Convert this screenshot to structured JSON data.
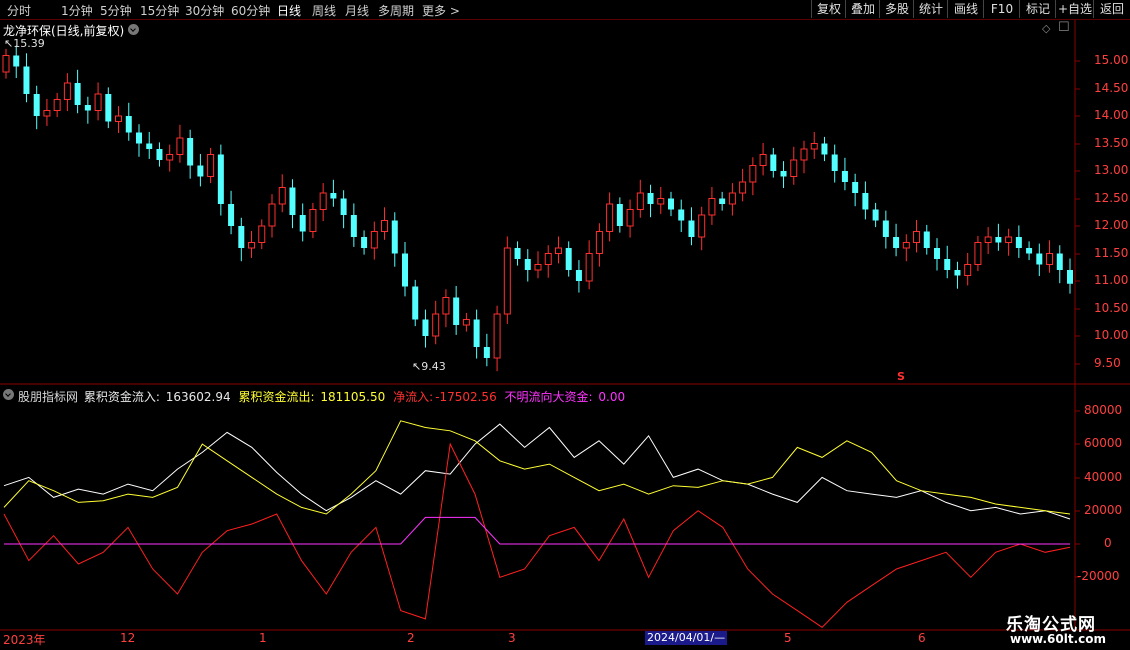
{
  "toolbar": {
    "timeframes": [
      "分时",
      "1分钟",
      "5分钟",
      "15分钟",
      "30分钟",
      "60分钟",
      "日线",
      "周线",
      "月线",
      "多周期",
      "更多 >"
    ],
    "active": "日线",
    "right_buttons": [
      "复权",
      "叠加",
      "多股",
      "统计",
      "画线",
      "F10",
      "标记",
      "+自选",
      "返回"
    ]
  },
  "price_panel": {
    "title": "龙净环保(日线,前复权)",
    "high_marker": "15.39",
    "low_marker": "9.43",
    "y_ticks": [
      "15.00",
      "14.50",
      "14.00",
      "13.50",
      "13.00",
      "12.50",
      "12.00",
      "11.50",
      "11.00",
      "10.50",
      "10.00",
      "9.50"
    ],
    "event_glyph": "S"
  },
  "indicator_panel": {
    "name": "股朋指标网",
    "items": [
      {
        "label": "累积资金流入:",
        "value": "163602.94",
        "color": "#e8e8e8"
      },
      {
        "label": "累积资金流出:",
        "value": "181105.50",
        "color": "#ffff33"
      },
      {
        "label": "净流入:",
        "value": "-17502.56",
        "color": "#ff3030"
      },
      {
        "label": "不明流向大资金:",
        "value": "0.00",
        "color": "#ff33ff"
      }
    ],
    "y_ticks": [
      "80000",
      "60000",
      "40000",
      "20000",
      "0",
      "-20000"
    ]
  },
  "date_axis": {
    "labels": [
      "2023年",
      "12",
      "1",
      "2",
      "3",
      "4",
      "5",
      "6"
    ],
    "cursor_date": "2024/04/01/—"
  },
  "watermark": {
    "line1": "乐淘公式网",
    "line2": "www.60lt.com"
  },
  "chart_data": [
    {
      "type": "candlestick",
      "title": "龙净环保(日线,前复权)",
      "ylim": [
        9.2,
        15.6
      ],
      "annotations": {
        "high": 15.39,
        "low": 9.43
      },
      "close": [
        15.1,
        14.9,
        14.4,
        14.0,
        14.1,
        14.3,
        14.6,
        14.2,
        14.1,
        14.4,
        13.9,
        14.0,
        13.7,
        13.5,
        13.4,
        13.2,
        13.3,
        13.6,
        13.1,
        12.9,
        13.3,
        12.4,
        12.0,
        11.6,
        11.7,
        12.0,
        12.4,
        12.7,
        12.2,
        11.9,
        12.3,
        12.6,
        12.5,
        12.2,
        11.8,
        11.6,
        11.9,
        12.1,
        11.5,
        10.9,
        10.3,
        10.0,
        10.4,
        10.7,
        10.2,
        10.3,
        9.8,
        9.6,
        10.4,
        11.6,
        11.4,
        11.2,
        11.3,
        11.5,
        11.6,
        11.2,
        11.0,
        11.5,
        11.9,
        12.4,
        12.0,
        12.3,
        12.6,
        12.4,
        12.5,
        12.3,
        12.1,
        11.8,
        12.2,
        12.5,
        12.4,
        12.6,
        12.8,
        13.1,
        13.3,
        13.0,
        12.9,
        13.2,
        13.4,
        13.5,
        13.3,
        13.0,
        12.8,
        12.6,
        12.3,
        12.1,
        11.8,
        11.6,
        11.7,
        11.9,
        11.6,
        11.4,
        11.2,
        11.1,
        11.3,
        11.7,
        11.8,
        11.7,
        11.8,
        11.6,
        11.5,
        11.3,
        11.5,
        11.2,
        10.95
      ]
    },
    {
      "type": "line",
      "ylim": [
        -25000,
        88000
      ],
      "categories": [
        "2023年",
        "12",
        "1",
        "2",
        "3",
        "4",
        "5",
        "6"
      ],
      "series": [
        {
          "name": "累积资金流入",
          "values": [
            35000,
            40000,
            28000,
            33000,
            30000,
            36000,
            32000,
            45000,
            55000,
            67000,
            58000,
            43000,
            30000,
            20000,
            28000,
            38000,
            30000,
            44000,
            42000,
            60000,
            72000,
            58000,
            70000,
            52000,
            62000,
            48000,
            65000,
            40000,
            45000,
            38000,
            36000,
            30000,
            25000,
            40000,
            32000,
            30000,
            28000,
            32000,
            25000,
            20000,
            22000,
            18000,
            20000,
            15000
          ]
        },
        {
          "name": "累积资金流出",
          "values": [
            22000,
            38000,
            32000,
            25000,
            26000,
            30000,
            28000,
            34000,
            60000,
            50000,
            40000,
            30000,
            22000,
            18000,
            30000,
            44000,
            74000,
            70000,
            68000,
            62000,
            50000,
            45000,
            48000,
            40000,
            32000,
            36000,
            30000,
            35000,
            34000,
            38000,
            36000,
            40000,
            58000,
            52000,
            62000,
            55000,
            38000,
            32000,
            30000,
            28000,
            24000,
            22000,
            20000,
            18000
          ]
        },
        {
          "name": "净流入",
          "values": [
            18000,
            -10000,
            5000,
            -12000,
            -5000,
            10000,
            -15000,
            -30000,
            -5000,
            8000,
            12000,
            18000,
            -10000,
            -30000,
            -5000,
            10000,
            -40000,
            -45000,
            60000,
            30000,
            -20000,
            -15000,
            5000,
            10000,
            -10000,
            15000,
            -20000,
            8000,
            20000,
            10000,
            -15000,
            -30000,
            -40000,
            -50000,
            -35000,
            -25000,
            -15000,
            -10000,
            -5000,
            -20000,
            -5000,
            0,
            -5000,
            -2000
          ]
        },
        {
          "name": "不明流向大资金",
          "values": [
            0,
            0,
            0,
            0,
            0,
            0,
            0,
            0,
            0,
            0,
            0,
            0,
            0,
            0,
            0,
            0,
            0,
            16000,
            16000,
            16000,
            0,
            0,
            0,
            0,
            0,
            0,
            0,
            0,
            0,
            0,
            0,
            0,
            0,
            0,
            0,
            0,
            0,
            0,
            0,
            0,
            0,
            0,
            0,
            0
          ]
        }
      ]
    }
  ]
}
